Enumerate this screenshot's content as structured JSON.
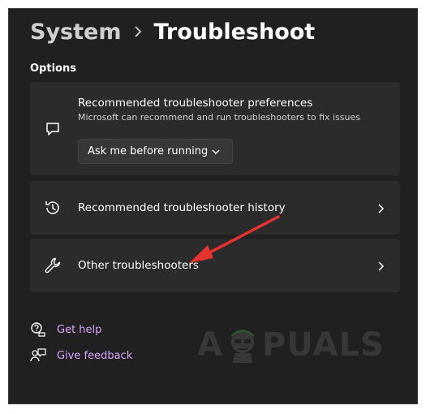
{
  "breadcrumb": {
    "parent": "System",
    "current": "Troubleshoot"
  },
  "section": {
    "label": "Options"
  },
  "cards": {
    "preferences": {
      "title": "Recommended troubleshooter preferences",
      "subtitle": "Microsoft can recommend and run troubleshooters to fix issues",
      "dropdown_value": "Ask me before running",
      "icon": "chat-bubble-icon"
    },
    "history": {
      "title": "Recommended troubleshooter history",
      "icon": "history-icon"
    },
    "other": {
      "title": "Other troubleshooters",
      "icon": "wrench-icon"
    }
  },
  "links": {
    "help": "Get help",
    "feedback": "Give feedback"
  },
  "watermark": {
    "text_left": "A",
    "text_right": "PUALS"
  },
  "colors": {
    "background": "#202020",
    "card": "#2b2b2b",
    "link": "#d9a4ff",
    "annotation_arrow": "#e5322d"
  }
}
